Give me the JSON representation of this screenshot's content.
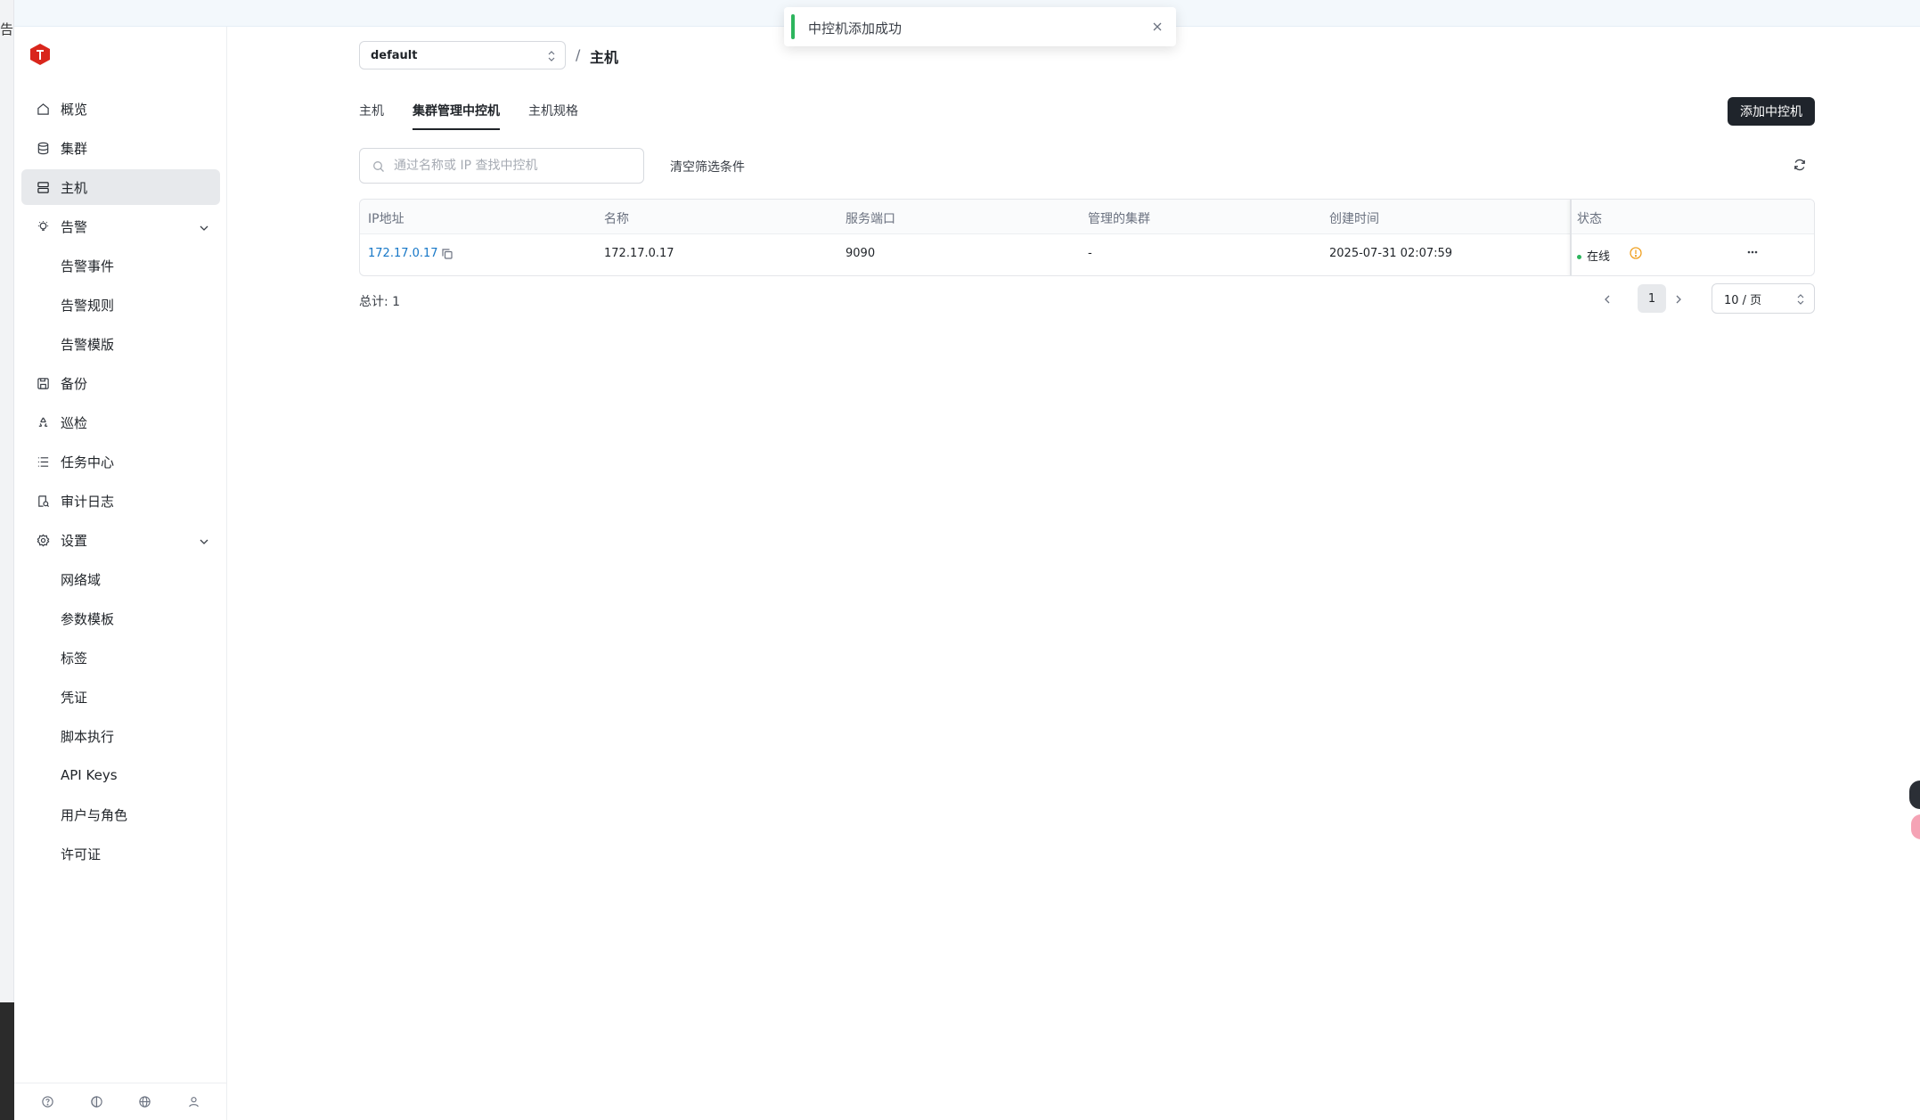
{
  "app": {
    "left_strip_text": "告"
  },
  "sidebar": {
    "items": [
      {
        "label": "概览",
        "icon": "home-icon"
      },
      {
        "label": "集群",
        "icon": "database-icon"
      },
      {
        "label": "主机",
        "icon": "server-icon",
        "active": true
      },
      {
        "label": "告警",
        "icon": "bulb-icon",
        "expanded": true,
        "children": [
          {
            "label": "告警事件"
          },
          {
            "label": "告警规则"
          },
          {
            "label": "告警模版"
          }
        ]
      },
      {
        "label": "备份",
        "icon": "save-icon"
      },
      {
        "label": "巡检",
        "icon": "recycle-icon"
      },
      {
        "label": "任务中心",
        "icon": "list-icon"
      },
      {
        "label": "审计日志",
        "icon": "audit-icon"
      },
      {
        "label": "设置",
        "icon": "gear-icon",
        "expanded": true,
        "children": [
          {
            "label": "网络域"
          },
          {
            "label": "参数模板"
          },
          {
            "label": "标签"
          },
          {
            "label": "凭证"
          },
          {
            "label": "脚本执行"
          },
          {
            "label": "API Keys"
          },
          {
            "label": "用户与角色"
          },
          {
            "label": "许可证"
          }
        ]
      }
    ],
    "bottom_icons": [
      "help-icon",
      "theme-icon",
      "globe-icon",
      "user-icon"
    ]
  },
  "header": {
    "workspace": "default",
    "separator": "/",
    "title": "主机"
  },
  "tabs": [
    {
      "label": "主机"
    },
    {
      "label": "集群管理中控机",
      "active": true
    },
    {
      "label": "主机规格"
    }
  ],
  "toolbar": {
    "add_label": "添加中控机",
    "search_placeholder": "通过名称或 IP 查找中控机",
    "clear_filter_label": "清空筛选条件"
  },
  "table": {
    "columns": [
      "IP地址",
      "名称",
      "服务端口",
      "管理的集群",
      "创建时间",
      "状态"
    ],
    "rows": [
      {
        "ip": "172.17.0.17",
        "name": "172.17.0.17",
        "port": "9090",
        "clusters": "-",
        "created": "2025-07-31 02:07:59",
        "status": "在线"
      }
    ]
  },
  "pagination": {
    "total_label": "总计: 1",
    "current_page": "1",
    "page_size": "10 / 页"
  },
  "toast": {
    "message": "中控机添加成功",
    "type": "success"
  },
  "colors": {
    "accent": "#1f242b",
    "link": "#1677c7",
    "success": "#2db55d",
    "warning": "#f0a020",
    "brand": "#d9261c"
  }
}
